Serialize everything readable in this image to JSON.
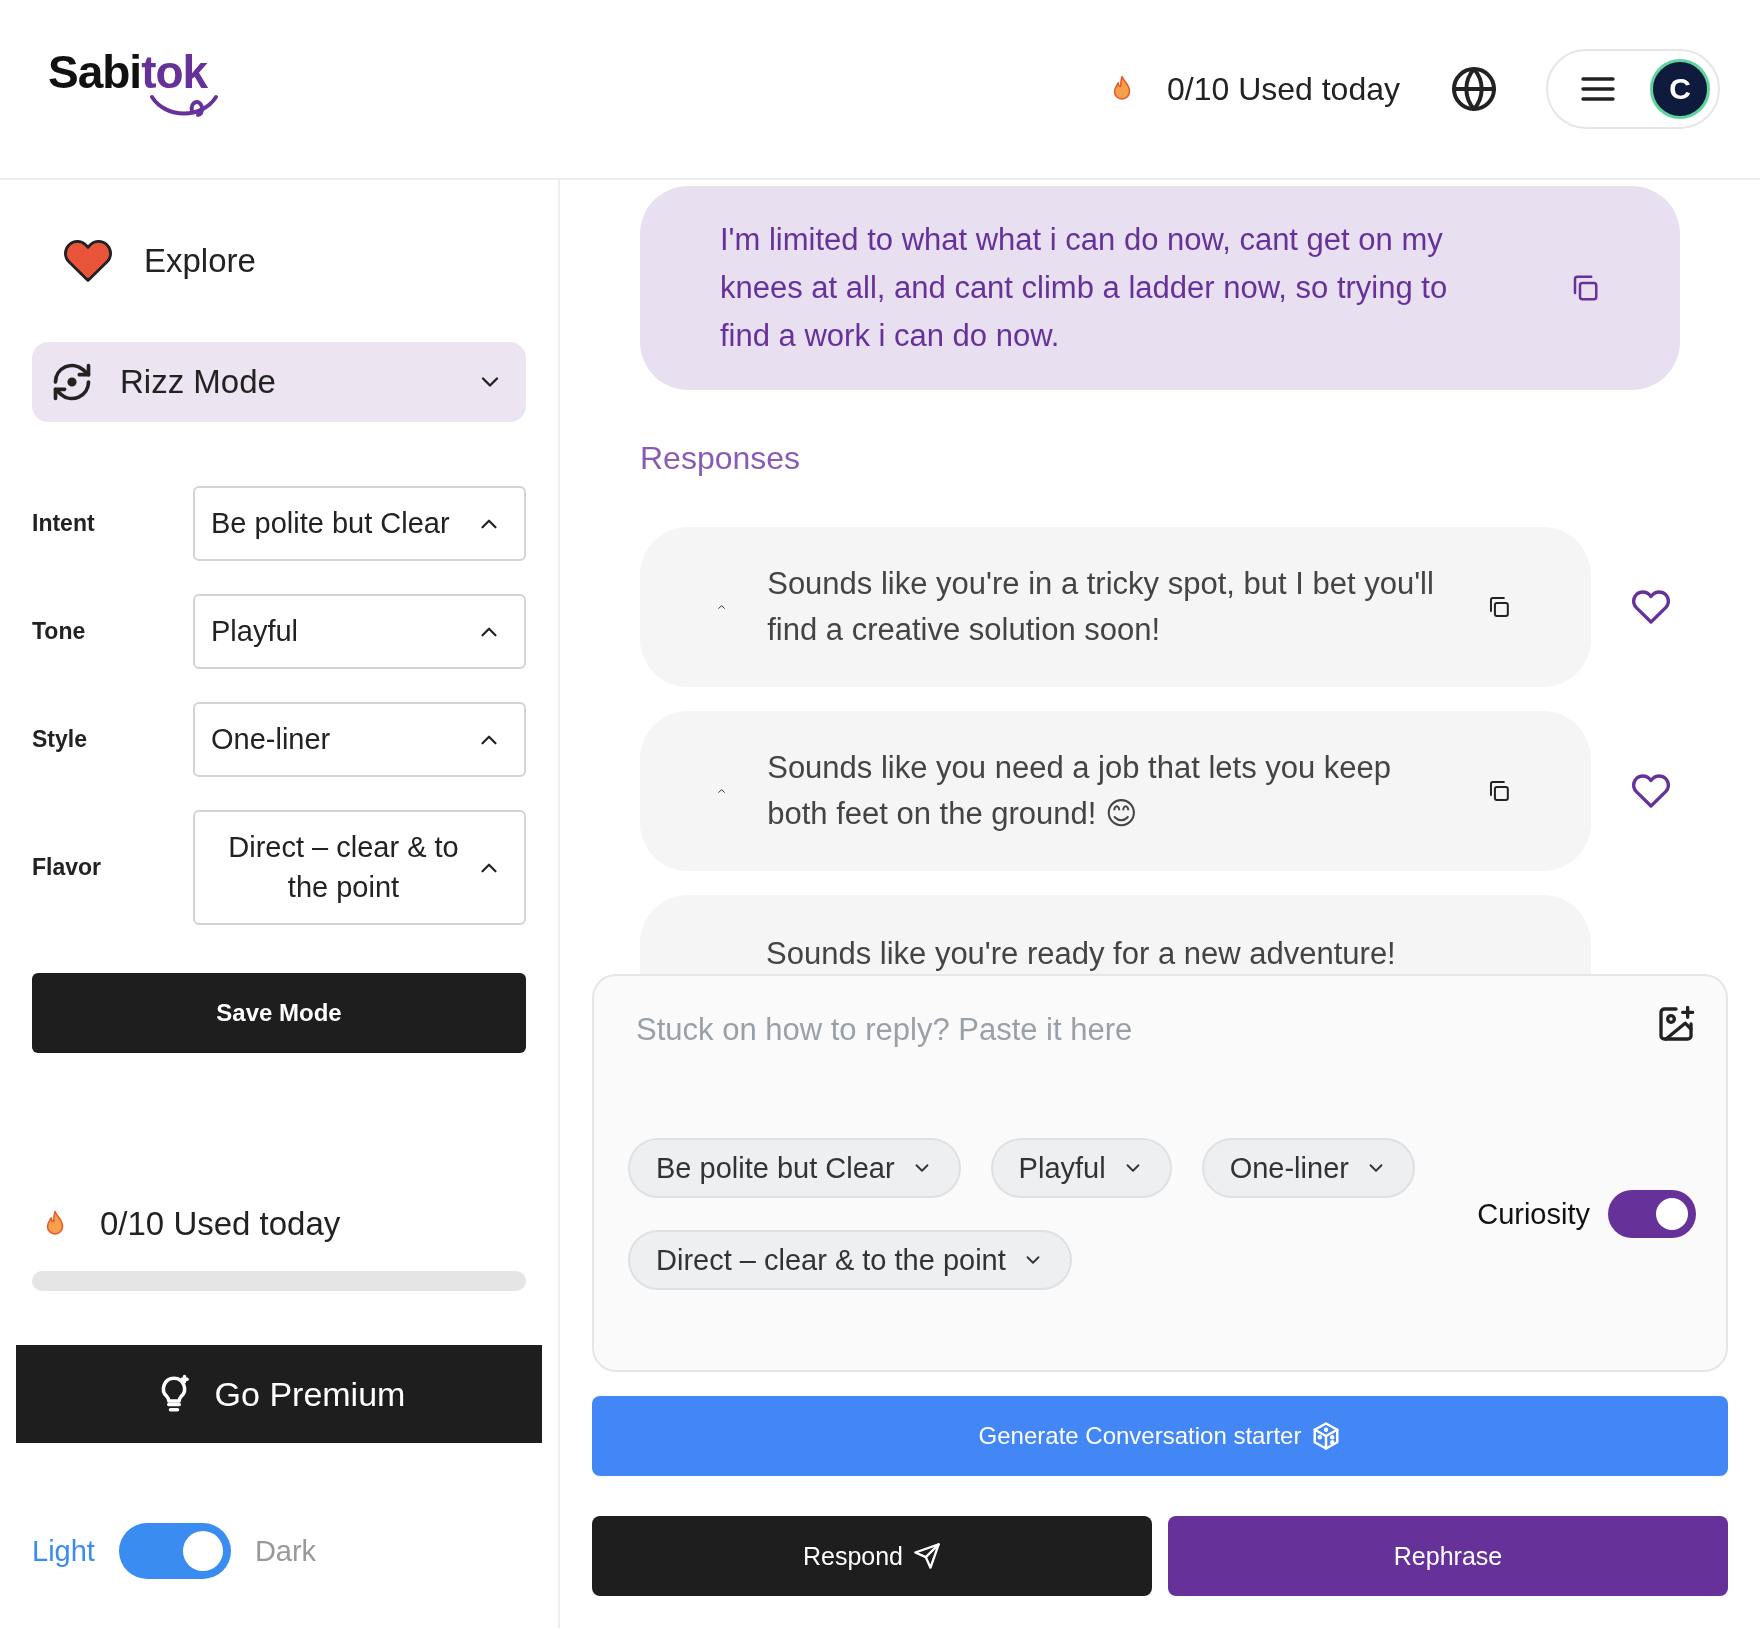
{
  "header": {
    "logo": {
      "dark": "Sabi",
      "accent": "tok"
    },
    "usage": "0/10 Used today",
    "avatar": "C"
  },
  "sidebar": {
    "explore": "Explore",
    "mode": {
      "label": "Rizz Mode"
    },
    "settings": [
      {
        "label": "Intent",
        "value": "Be polite but Clear"
      },
      {
        "label": "Tone",
        "value": "Playful"
      },
      {
        "label": "Style",
        "value": "One-liner"
      },
      {
        "label": "Flavor",
        "value": "Direct – clear & to the point"
      }
    ],
    "save": "Save Mode",
    "usage": {
      "text": "0/10 Used today",
      "level": 0
    },
    "premium": "Go Premium",
    "theme_toggle": {
      "on": true
    },
    "theme": [
      {
        "label": "Light",
        "selected": true
      },
      {
        "label": "Dark",
        "selected": false
      }
    ]
  },
  "main": {
    "message": "I'm limited to what what i can do now, cant get on my knees at all, and cant climb a ladder now, so trying to find a work i can do now.",
    "responses_title": "Responses",
    "responses": [
      {
        "kind": "full",
        "text": "Sounds like you're in a tricky spot, but I bet you'll find a creative solution soon!",
        "liked": false
      },
      {
        "kind": "full",
        "text": "Sounds like you need a job that lets you keep both feet on the ground! 😊",
        "liked": false
      },
      {
        "kind": "cut",
        "text": "Sounds like you're ready for a new adventure!"
      }
    ],
    "composer": {
      "placeholder": "Stuck on how to reply? Paste it here",
      "chips": [
        "Be polite but Clear",
        "Playful",
        "One-liner",
        "Direct – clear & to the point"
      ],
      "curiosity": {
        "label": "Curiosity",
        "on": true
      }
    },
    "generate": "Generate Conversation starter",
    "respond": "Respond",
    "rephrase": "Rephrase"
  }
}
